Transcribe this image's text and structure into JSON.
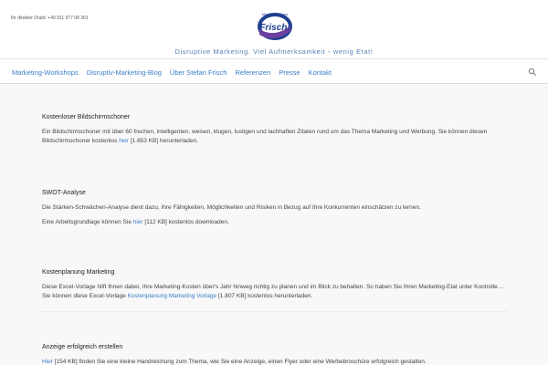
{
  "header": {
    "contact_line": "Ihr direkter Draht: +49 911 977 08 301",
    "logo_top": "Marketing-Tipps",
    "logo_brand": "Frisch!",
    "tagline": "Disruptive Marketing. Viel Aufmerksamkeit - wenig Etat!"
  },
  "nav": {
    "items": [
      {
        "label": "Marketing-Workshops"
      },
      {
        "label": "Disruptiv-Marketing-Blog"
      },
      {
        "label": "Über Stefan Frisch"
      },
      {
        "label": "Referenzen"
      },
      {
        "label": "Presse"
      },
      {
        "label": "Kontakt"
      }
    ],
    "search_icon": "search-icon"
  },
  "sections": [
    {
      "title": "Kostenloser Bildschirmschoner",
      "paragraphs": [
        {
          "pre": "Ein Bildschirmschoner mit über 60 frechen, intelligenten, weisen, klugen, lustigen und lachhaften Zitaten rund um das Thema Marketing und Werbung. Sie können diesen Bildschirmschoner kostenlos ",
          "link": "hier",
          "post": " [1.653 KB] herunterladen."
        }
      ]
    },
    {
      "title": "SWOT-Analyse",
      "paragraphs": [
        {
          "text": "Die Stärken-Schwächen-Analyse dient dazu, Ihre Fähigkeiten, Möglichkeiten und Risiken in Bezug auf Ihre Konkurrenten einschätzen zu lernen."
        },
        {
          "pre": "Eine Arbeitsgrundlage können Sie ",
          "link": "hier",
          "post": " [112 KB] kostenlos downloaden."
        }
      ]
    },
    {
      "title": "Kostenplanung Marketing",
      "paragraphs": [
        {
          "pre": "Diese Excel-Vorlage hilft Ihnen dabei, Ihre Marketing-Kosten über's Jahr hinweg richtig zu planen und im Blick zu behalten. So haben Sie Ihren Marketing-Etat unter Kontrolle… Sie können diese Excel-Vorlage ",
          "link": "Kostenplanung Marketing Vorlage",
          "post": " [1.807 KB] kostenlos herunterladen."
        }
      ]
    },
    {
      "title": "Anzeige erfolgreich erstellen",
      "paragraphs": [
        {
          "pre": "",
          "link": "Hier",
          "post": " [154 KB] finden Sie eine kleine Handreichung zum Thema, wie Sie eine Anzeige, einen Flyer oder eine Werbebroschüre erfolgreich gestalten."
        }
      ]
    }
  ],
  "colors": {
    "link": "#3a7ec8",
    "tagline": "#5b7fb4",
    "logo_blue": "#1f3f8f",
    "logo_purple": "#6b3fa0"
  }
}
